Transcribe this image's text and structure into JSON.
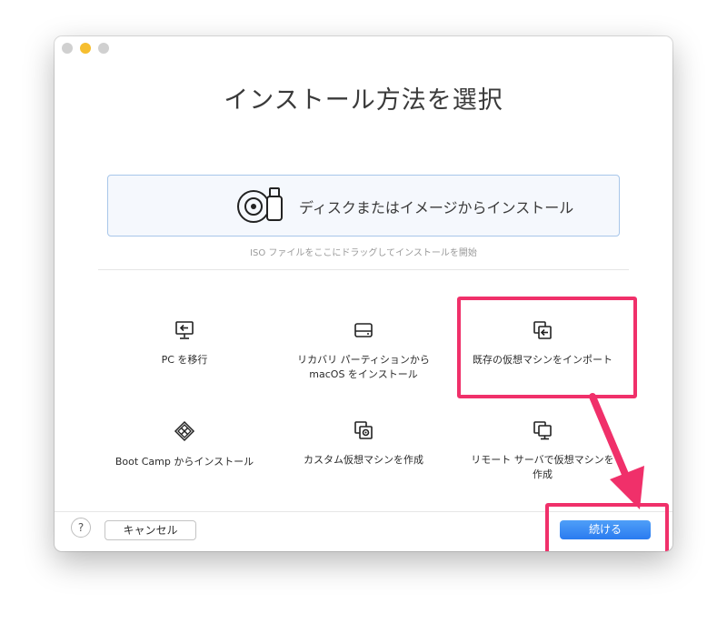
{
  "window": {
    "title": "インストール方法を選択"
  },
  "disk_option": {
    "label": "ディスクまたはイメージからインストール",
    "icon": "disc-usb-icon"
  },
  "hint": "ISO ファイルをここにドラッグしてインストールを開始",
  "options": [
    {
      "label": "PC を移行",
      "icon": "monitor-arrow-icon"
    },
    {
      "label": "リカバリ パーティションから\nmacOS をインストール",
      "icon": "drive-icon"
    },
    {
      "label": "既存の仮想マシンをインポート",
      "icon": "import-vm-icon"
    },
    {
      "label": "Boot Camp からインストール",
      "icon": "bootcamp-icon"
    },
    {
      "label": "カスタム仮想マシンを作成",
      "icon": "custom-vm-icon"
    },
    {
      "label": "リモート サーバで仮想マシンを\n作成",
      "icon": "remote-server-icon"
    }
  ],
  "buttons": {
    "help": "?",
    "cancel": "キャンセル",
    "continue": "続ける"
  },
  "colors": {
    "accent": "#2a7bf0",
    "highlight": "#f0306a"
  }
}
